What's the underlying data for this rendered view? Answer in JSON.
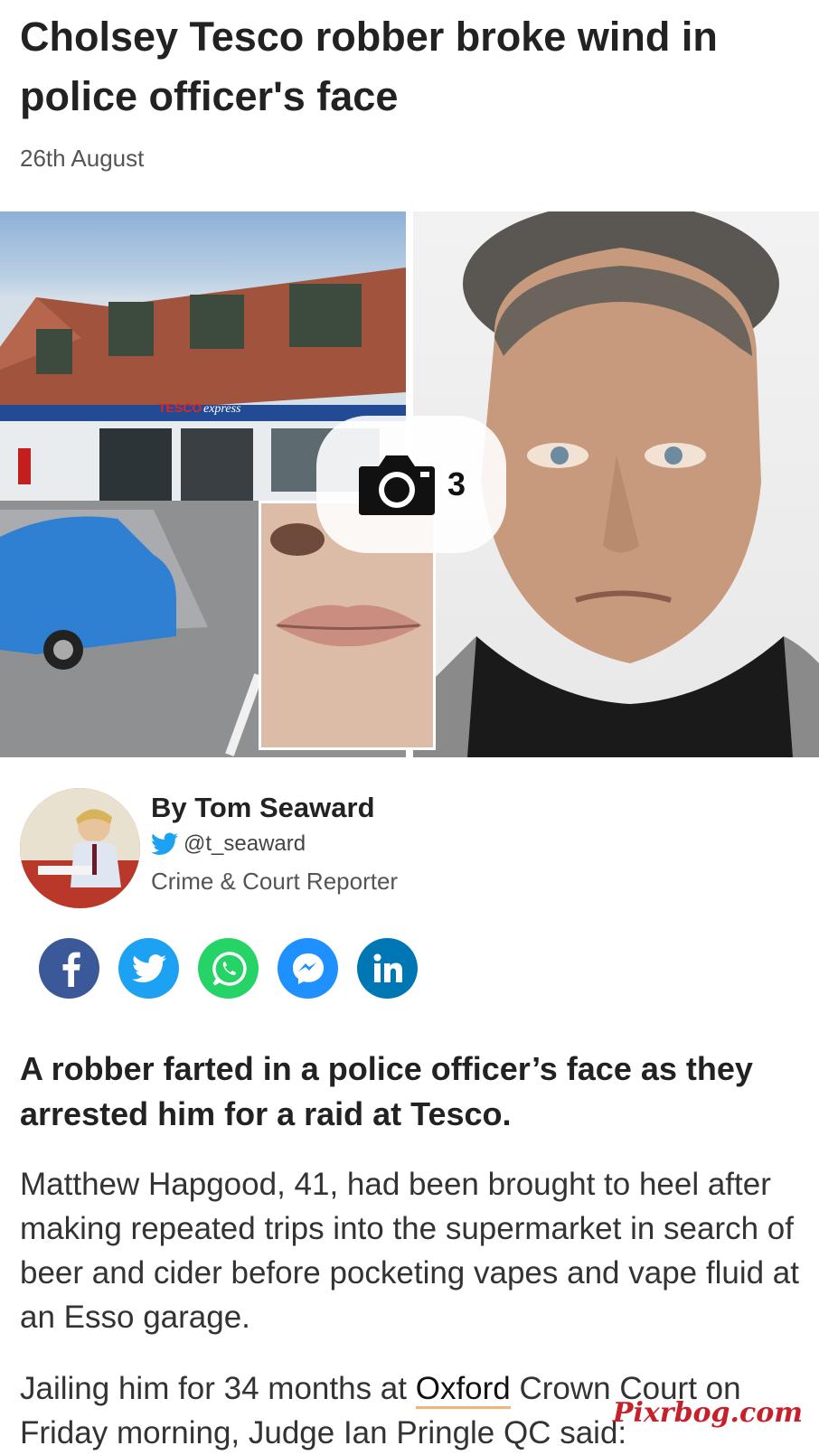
{
  "article": {
    "headline": "Cholsey Tesco robber broke wind in police officer's face",
    "date": "26th August"
  },
  "gallery": {
    "photo_count": "3",
    "store_sign": "TESCO",
    "store_sign_sub": "express"
  },
  "author": {
    "name": "By Tom Seaward",
    "handle": "@t_seaward",
    "role": "Crime & Court Reporter"
  },
  "share": [
    {
      "network": "facebook",
      "color": "#3b5998",
      "icon": "facebook-icon"
    },
    {
      "network": "twitter",
      "color": "#1da1f2",
      "icon": "twitter-icon"
    },
    {
      "network": "whatsapp",
      "color": "#25d366",
      "icon": "whatsapp-icon"
    },
    {
      "network": "messenger",
      "color": "#0084ff",
      "icon": "messenger-icon"
    },
    {
      "network": "linkedin",
      "color": "#0077b5",
      "icon": "linkedin-icon"
    }
  ],
  "body": {
    "standfirst": "A robber farted in a police officer’s face as they arrested him for a raid at Tesco.",
    "paragraph1": "Matthew Hapgood, 41, had been brought to heel after making repeated trips into the supermarket in search of beer and cider before pocketing vapes and vape fluid at an Esso garage.",
    "paragraph2_start": "Jailing him for 34 months at ",
    "paragraph2_link": "Oxford",
    "paragraph2_end": " Crown Court on Friday morning, Judge Ian Pringle QC said:"
  },
  "watermark": "Pixrbog.com"
}
